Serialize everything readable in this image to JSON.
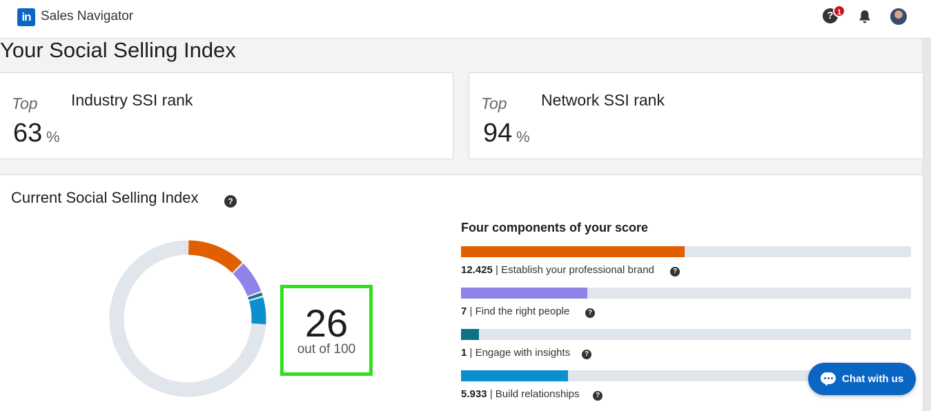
{
  "app": {
    "brand": "Sales Navigator",
    "logo_text": "in",
    "notifications_count": "1",
    "help_glyph": "?"
  },
  "page": {
    "title": "Your Social Selling Index"
  },
  "ranks": [
    {
      "prefix": "Top",
      "value": "63",
      "unit": "%",
      "label": "Industry SSI rank"
    },
    {
      "prefix": "Top",
      "value": "94",
      "unit": "%",
      "label": "Network SSI rank"
    }
  ],
  "ssi": {
    "title": "Current Social Selling Index",
    "score": "26",
    "score_sub": "out of 100",
    "components_title": "Four components of your score",
    "components": [
      {
        "value": "12.425",
        "label": "Establish your professional brand",
        "fraction": 0.497,
        "color": "#e06000"
      },
      {
        "value": "7",
        "label": "Find the right people",
        "fraction": 0.28,
        "color": "#8f82e8"
      },
      {
        "value": "1",
        "label": "Engage with insights",
        "fraction": 0.04,
        "color": "#0e7285"
      },
      {
        "value": "5.933",
        "label": "Build relationships",
        "fraction": 0.237,
        "color": "#0b8fcf"
      }
    ]
  },
  "chat": {
    "label": "Chat with us"
  },
  "icons": {
    "logo": "linkedin-logo-icon",
    "help": "help-icon",
    "bell": "bell-icon",
    "avatar": "avatar",
    "chat": "chat-bubble-icon"
  }
}
